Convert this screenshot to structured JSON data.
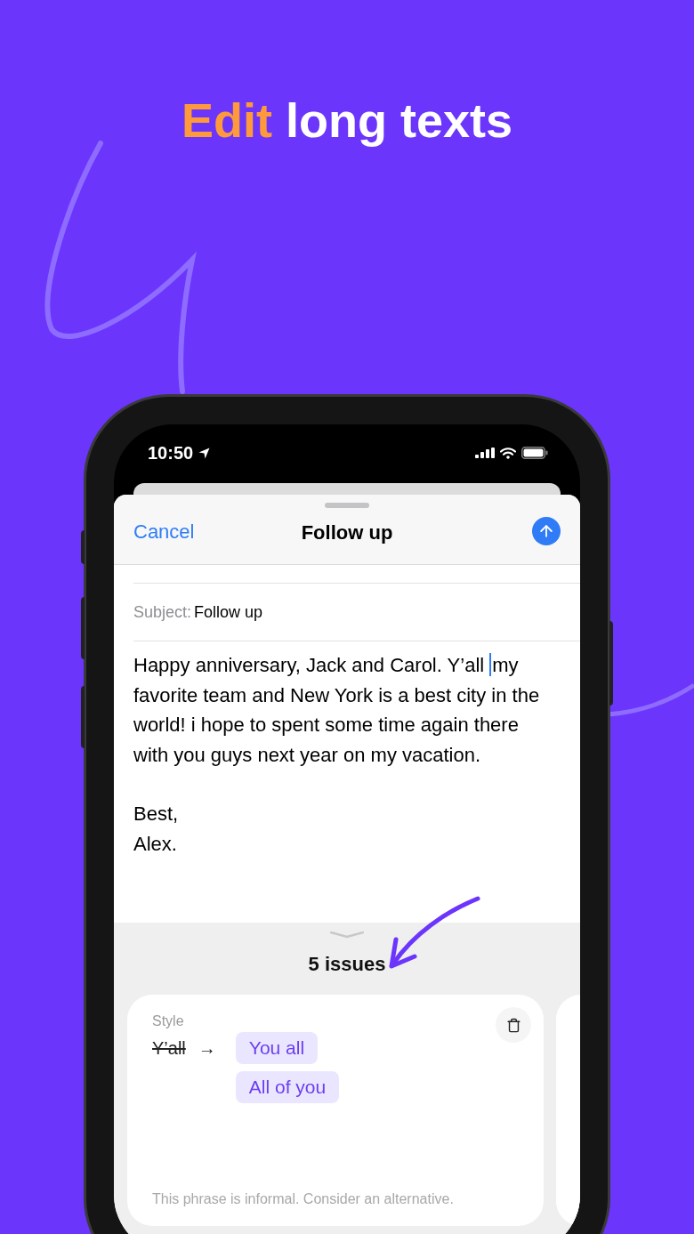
{
  "headline": {
    "accent": "Edit",
    "rest": "long texts"
  },
  "status_bar": {
    "time": "10:50"
  },
  "sheet": {
    "cancel": "Cancel",
    "title": "Follow up"
  },
  "subject": {
    "label": "Subject:",
    "value": "Follow up"
  },
  "body": {
    "text_before_cursor": "Happy anniversary, Jack and Carol. Y’all ",
    "text_after_cursor": "my favorite team and New York is a best city in the world! i hope to spent some time again there with you guys next year on my vacation.",
    "signoff": [
      "Best,",
      "Alex."
    ]
  },
  "issues": {
    "count": "5 issues",
    "cards": [
      {
        "category": "Style",
        "original": "Y’all",
        "arrow": "→",
        "suggestions": [
          "You all",
          "All of you"
        ],
        "note": "This phrase is informal. Consider an alternative."
      }
    ]
  }
}
